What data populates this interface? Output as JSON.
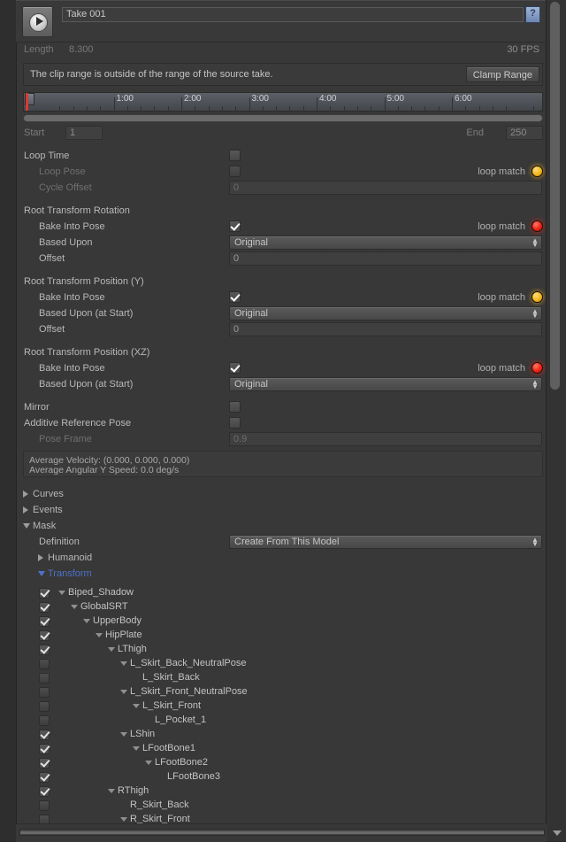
{
  "window": {
    "clip_name": "Take 001",
    "clip_icon": "animation-clip-icon",
    "help_icon": "help-book-icon"
  },
  "clip_info": {
    "length_label": "Length",
    "length_value": "8.300",
    "fps": "30 FPS"
  },
  "warning": {
    "message": "The clip range is outside of the range of the source take.",
    "button_label": "Clamp Range"
  },
  "timeline": {
    "tick_labels": [
      "1:00",
      "2:00",
      "3:00",
      "4:00",
      "5:00",
      "6:00"
    ],
    "start_label": "Start",
    "start_value": "1",
    "end_label": "End",
    "end_value": "250"
  },
  "properties": [
    {
      "label": "Loop Time",
      "indent": 0,
      "dim": false,
      "control": "checkbox",
      "checked": false,
      "loop_match": null
    },
    {
      "label": "Loop Pose",
      "indent": 1,
      "dim": true,
      "control": "checkbox",
      "checked": false,
      "loop_match": "yellow",
      "loop_match_label": "loop match"
    },
    {
      "label": "Cycle Offset",
      "indent": 1,
      "dim": true,
      "control": "text",
      "value": "0",
      "loop_match": null
    },
    {
      "label": "Root Transform Rotation",
      "indent": 0,
      "dim": false,
      "control": "none",
      "loop_match": null
    },
    {
      "label": "Bake Into Pose",
      "indent": 1,
      "dim": false,
      "control": "checkbox",
      "checked": true,
      "loop_match": "red",
      "loop_match_label": "loop match"
    },
    {
      "label": "Based Upon",
      "indent": 1,
      "dim": false,
      "control": "dropdown",
      "value": "Original",
      "loop_match": null
    },
    {
      "label": "Offset",
      "indent": 1,
      "dim": false,
      "control": "text",
      "value": "0",
      "loop_match": null
    },
    {
      "label": "Root Transform Position (Y)",
      "indent": 0,
      "dim": false,
      "control": "none",
      "loop_match": null
    },
    {
      "label": "Bake Into Pose",
      "indent": 1,
      "dim": false,
      "control": "checkbox",
      "checked": true,
      "loop_match": "yellow",
      "loop_match_label": "loop match"
    },
    {
      "label": "Based Upon (at Start)",
      "indent": 1,
      "dim": false,
      "control": "dropdown",
      "value": "Original",
      "loop_match": null
    },
    {
      "label": "Offset",
      "indent": 1,
      "dim": false,
      "control": "text",
      "value": "0",
      "loop_match": null
    },
    {
      "label": "Root Transform Position (XZ)",
      "indent": 0,
      "dim": false,
      "control": "none",
      "loop_match": null
    },
    {
      "label": "Bake Into Pose",
      "indent": 1,
      "dim": false,
      "control": "checkbox",
      "checked": true,
      "loop_match": "red",
      "loop_match_label": "loop match"
    },
    {
      "label": "Based Upon (at Start)",
      "indent": 1,
      "dim": false,
      "control": "dropdown",
      "value": "Original",
      "loop_match": null
    },
    {
      "label": "Mirror",
      "indent": 0,
      "dim": false,
      "control": "checkbox",
      "checked": false,
      "loop_match": null
    },
    {
      "label": "Additive Reference Pose",
      "indent": 0,
      "dim": false,
      "control": "checkbox",
      "checked": false,
      "loop_match": null
    },
    {
      "label": "Pose Frame",
      "indent": 1,
      "dim": true,
      "control": "text",
      "value": "0.9",
      "loop_match": null
    }
  ],
  "stats": {
    "line1": "Average Velocity: (0.000, 0.000, 0.000)",
    "line2": "Average Angular Y Speed: 0.0 deg/s"
  },
  "foldouts": [
    {
      "label": "Curves",
      "open": false,
      "indent": 0,
      "highlight": false
    },
    {
      "label": "Events",
      "open": false,
      "indent": 0,
      "highlight": false
    },
    {
      "label": "Mask",
      "open": true,
      "indent": 0,
      "highlight": false
    }
  ],
  "mask": {
    "definition_label": "Definition",
    "definition_value": "Create From This Model",
    "humanoid_label": "Humanoid",
    "humanoid_open": false,
    "transform_label": "Transform",
    "transform_open": true
  },
  "transform_tree": [
    {
      "name": "Biped_Shadow",
      "depth": 0,
      "checked": true,
      "arrow": "open"
    },
    {
      "name": "GlobalSRT",
      "depth": 1,
      "checked": true,
      "arrow": "open"
    },
    {
      "name": "UpperBody",
      "depth": 2,
      "checked": true,
      "arrow": "open"
    },
    {
      "name": "HipPlate",
      "depth": 3,
      "checked": true,
      "arrow": "open"
    },
    {
      "name": "LThigh",
      "depth": 4,
      "checked": true,
      "arrow": "open"
    },
    {
      "name": "L_Skirt_Back_NeutralPose",
      "depth": 5,
      "checked": false,
      "arrow": "open"
    },
    {
      "name": "L_Skirt_Back",
      "depth": 6,
      "checked": false,
      "arrow": "none"
    },
    {
      "name": "L_Skirt_Front_NeutralPose",
      "depth": 5,
      "checked": false,
      "arrow": "open"
    },
    {
      "name": "L_Skirt_Front",
      "depth": 6,
      "checked": false,
      "arrow": "open"
    },
    {
      "name": "L_Pocket_1",
      "depth": 7,
      "checked": false,
      "arrow": "none"
    },
    {
      "name": "LShin",
      "depth": 5,
      "checked": true,
      "arrow": "open"
    },
    {
      "name": "LFootBone1",
      "depth": 6,
      "checked": true,
      "arrow": "open"
    },
    {
      "name": "LFootBone2",
      "depth": 7,
      "checked": true,
      "arrow": "open"
    },
    {
      "name": "LFootBone3",
      "depth": 8,
      "checked": true,
      "arrow": "none"
    },
    {
      "name": "RThigh",
      "depth": 4,
      "checked": true,
      "arrow": "open"
    },
    {
      "name": "R_Skirt_Back",
      "depth": 5,
      "checked": false,
      "arrow": "none"
    },
    {
      "name": "R_Skirt_Front",
      "depth": 5,
      "checked": false,
      "arrow": "open"
    }
  ],
  "colors": {
    "panel_bg": "#383838",
    "accent_blue": "#4d72c8",
    "loop_match_yellow": "#f5b51c",
    "loop_match_red": "#ee2211",
    "playhead_red": "#d63b34"
  }
}
